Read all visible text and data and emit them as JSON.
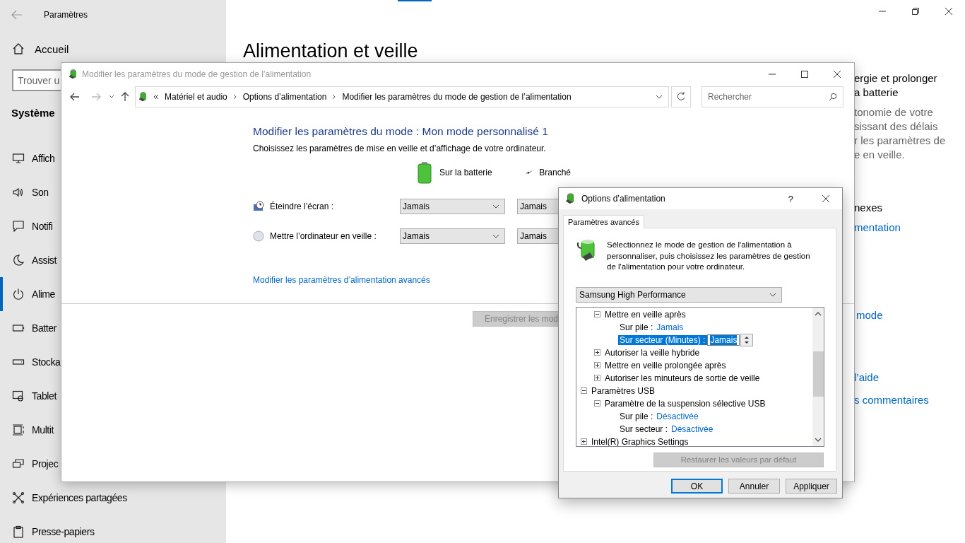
{
  "settings": {
    "title": "Paramètres",
    "home": "Accueil",
    "search": {
      "placeholder": "Trouver u"
    },
    "section": "Système",
    "page_title": "Alimentation et veille",
    "nav": [
      {
        "label": "Affich",
        "selected": false
      },
      {
        "label": "Son",
        "selected": false
      },
      {
        "label": "Notifi",
        "selected": false
      },
      {
        "label": "Assist",
        "selected": false
      },
      {
        "label": "Alime",
        "selected": true
      },
      {
        "label": "Batter",
        "selected": false
      },
      {
        "label": "Stocka",
        "selected": false
      },
      {
        "label": "Tablet",
        "selected": false
      },
      {
        "label": "Multit",
        "selected": false
      },
      {
        "label": "Projec",
        "selected": false
      },
      {
        "label": "Expériences partagées",
        "selected": false
      },
      {
        "label": "Presse-papiers",
        "selected": false
      }
    ],
    "right_column": {
      "heading_lines": [
        "ergie et prolonger",
        "a batterie"
      ],
      "description_lines": [
        "tonomie de votre",
        "sissant des délais",
        "r les paramètres de",
        "e en veille."
      ],
      "related_heading": "nexes",
      "related_link": "mentation",
      "mode_link": "mode",
      "help_link": "l’aide",
      "feedback_link": "s commentaires"
    }
  },
  "control_panel": {
    "title": "Modifier les paramètres du mode de gestion de l’alimentation",
    "breadcrumb": [
      "Matériel et audio",
      "Options d’alimentation",
      "Modifier les paramètres du mode de gestion de l’alimentation"
    ],
    "search": {
      "placeholder": "Rechercher"
    },
    "heading": "Modifier les paramètres du mode : Mon mode personnalisé 1",
    "subtitle": "Choisissez les paramètres de mise en veille et d’affichage de votre ordinateur.",
    "columns": [
      {
        "kind": "battery",
        "label": "Sur la batterie"
      },
      {
        "kind": "plugged",
        "label": "Branché"
      }
    ],
    "rows": [
      {
        "kind": "display",
        "label": "Éteindre l’écran :",
        "values": [
          "Jamais",
          "Jamais"
        ]
      },
      {
        "kind": "sleep",
        "label": "Mettre l’ordinateur en veille :",
        "values": [
          "Jamais",
          "Jamais"
        ]
      }
    ],
    "advanced_link": "Modifier les paramètres d’alimentation avancés",
    "save_button": {
      "label": "Enregistrer les mod",
      "disabled": true
    }
  },
  "dialog": {
    "title": "Options d’alimentation",
    "help": "?",
    "tabs": [
      {
        "label": "Paramètres avancés",
        "selected": true
      }
    ],
    "description": "Sélectionnez le mode de gestion de l'alimentation à personnaliser, puis choisissez les paramètres de gestion de l'alimentation pour votre ordinateur.",
    "plan": "Samsung High Performance",
    "tree": [
      {
        "children": [
          {
            "label": "Mettre en veille après",
            "expanded": true,
            "children": [
              {
                "kind": "setting",
                "label": "Sur pile :",
                "value": "Jamais",
                "selected": false
              },
              {
                "kind": "editing",
                "label": "Sur secteur (Minutes) :",
                "value": "Jamais",
                "selected": true
              }
            ]
          },
          {
            "label": "Autoriser la veille hybride",
            "expanded": false
          },
          {
            "label": "Mettre en veille prolongée après",
            "expanded": false
          },
          {
            "label": "Autoriser les minuteurs de sortie de veille",
            "expanded": false
          }
        ]
      },
      {
        "label": "Paramètres USB",
        "expanded": true,
        "children": [
          {
            "label": "Paramètre de la suspension sélective USB",
            "expanded": true,
            "children": [
              {
                "kind": "setting",
                "label": "Sur pile :",
                "value": "Désactivée",
                "selected": false
              },
              {
                "kind": "setting",
                "label": "Sur secteur :",
                "value": "Désactivée",
                "selected": false
              }
            ]
          }
        ]
      },
      {
        "label": "Intel(R) Graphics Settings",
        "expanded": false
      }
    ],
    "restore_button": {
      "label": "Restaurer les valeurs par défaut",
      "disabled": true
    },
    "buttons": [
      {
        "label": "OK",
        "default": true
      },
      {
        "label": "Annuler",
        "default": false
      },
      {
        "label": "Appliquer",
        "default": false
      }
    ]
  }
}
